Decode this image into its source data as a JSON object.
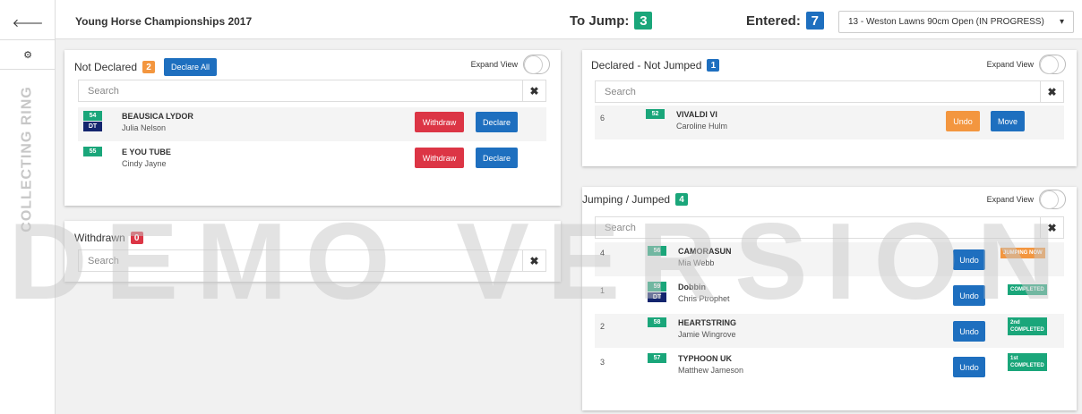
{
  "sidebar": {
    "back_icon": "arrow-left-icon",
    "settings_icon": "cogs-icon",
    "vertical_label": "COLLECTING RING"
  },
  "header": {
    "title": "Young Horse Championships 2017",
    "to_jump_label": "To Jump:",
    "to_jump_count": "3",
    "entered_label": "Entered:",
    "entered_count": "7",
    "class_select": "13 - Weston Lawns 90cm Open (IN PROGRESS)"
  },
  "not_declared": {
    "title": "Not Declared",
    "count": "2",
    "declare_all_label": "Declare All",
    "expand_label": "Expand View",
    "search_placeholder": "Search",
    "rows": [
      {
        "num": "54",
        "dt": "DT",
        "horse": "BEAUSICA LYDOR",
        "rider": "Julia Nelson",
        "withdraw": "Withdraw",
        "declare": "Declare"
      },
      {
        "num": "55",
        "dt": "",
        "horse": "E YOU TUBE",
        "rider": "Cindy Jayne",
        "withdraw": "Withdraw",
        "declare": "Declare"
      }
    ]
  },
  "withdrawn": {
    "title": "Withdrawn",
    "count": "0",
    "search_placeholder": "Search"
  },
  "declared_not_jumped": {
    "title": "Declared - Not Jumped",
    "count": "1",
    "expand_label": "Expand View",
    "search_placeholder": "Search",
    "rows": [
      {
        "pos": "6",
        "num": "52",
        "horse": "VIVALDI VI",
        "rider": "Caroline Hulm",
        "undo": "Undo",
        "move": "Move"
      }
    ]
  },
  "jumping": {
    "title": "Jumping / Jumped",
    "count": "4",
    "expand_label": "Expand View",
    "search_placeholder": "Search",
    "rows": [
      {
        "pos": "4",
        "num": "56",
        "dt": "",
        "horse": "CAMORASUN",
        "rider": "Mia Webb",
        "undo": "Undo",
        "place": "",
        "status": "JUMPING NOW"
      },
      {
        "pos": "1",
        "num": "59",
        "dt": "DT",
        "horse": "Dobbin",
        "rider": "Chris Ptrophet",
        "undo": "Undo",
        "place": "",
        "status": "COMPLETED"
      },
      {
        "pos": "2",
        "num": "58",
        "dt": "",
        "horse": "HEARTSTRING",
        "rider": "Jamie Wingrove",
        "undo": "Undo",
        "place": "2nd",
        "status": "COMPLETED"
      },
      {
        "pos": "3",
        "num": "57",
        "dt": "",
        "horse": "TYPHOON UK",
        "rider": "Matthew Jameson",
        "undo": "Undo",
        "place": "1st",
        "status": "COMPLETED"
      }
    ]
  },
  "watermark": "DEMO VERSION",
  "colors": {
    "green": "#1aa67a",
    "blue": "#1e6fbf",
    "orange": "#f3963f",
    "red": "#dc3545",
    "navy": "#13256e"
  }
}
